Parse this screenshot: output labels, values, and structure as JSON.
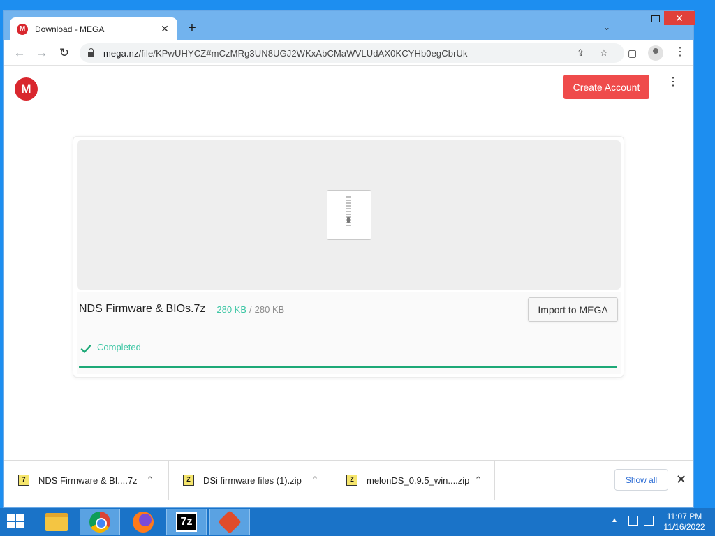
{
  "browser": {
    "tab_title": "Download - MEGA",
    "favicon_letter": "M",
    "tab_close": "✕",
    "new_tab": "+",
    "tab_search": "⌄",
    "win_close": "✕",
    "url_host": "mega.nz",
    "url_path": "/file/KPwUHYCZ#mCzMRg3UN8UGJ2WKxAbCMaWVLUdAX0KCYHb0egCbrUk",
    "nav_back": "←",
    "nav_forward": "→",
    "nav_reload": "↻",
    "share_icon": "⇪",
    "star_icon": "☆",
    "sidepanel_icon": "▢",
    "menu_icon": "⋮"
  },
  "page": {
    "logo_letter": "M",
    "create_account": "Create Account",
    "menu_icon": "⋮",
    "file_name": "NDS Firmware & BIOs.7z",
    "size_downloaded": "280 KB",
    "size_separator": "/",
    "size_total": "280 KB",
    "import_button": "Import to MEGA",
    "status": "Completed",
    "progress_percent": 100,
    "accent_color": "#1da977",
    "brand_color": "#d9272e"
  },
  "downloads": {
    "items": [
      {
        "name": "NDS Firmware & BI....7z",
        "icon": "7z"
      },
      {
        "name": "DSi firmware files (1).zip",
        "icon": "Z"
      },
      {
        "name": "melonDS_0.9.5_win....zip",
        "icon": "Z"
      }
    ],
    "caret": "⌃",
    "show_all": "Show all",
    "close": "✕"
  },
  "taskbar": {
    "apps": [
      "file-explorer",
      "chrome",
      "firefox",
      "7-zip",
      "melonds"
    ],
    "sevenzip_label": "7z",
    "tray_arrow": "▲",
    "time": "11:07 PM",
    "date": "11/16/2022"
  }
}
